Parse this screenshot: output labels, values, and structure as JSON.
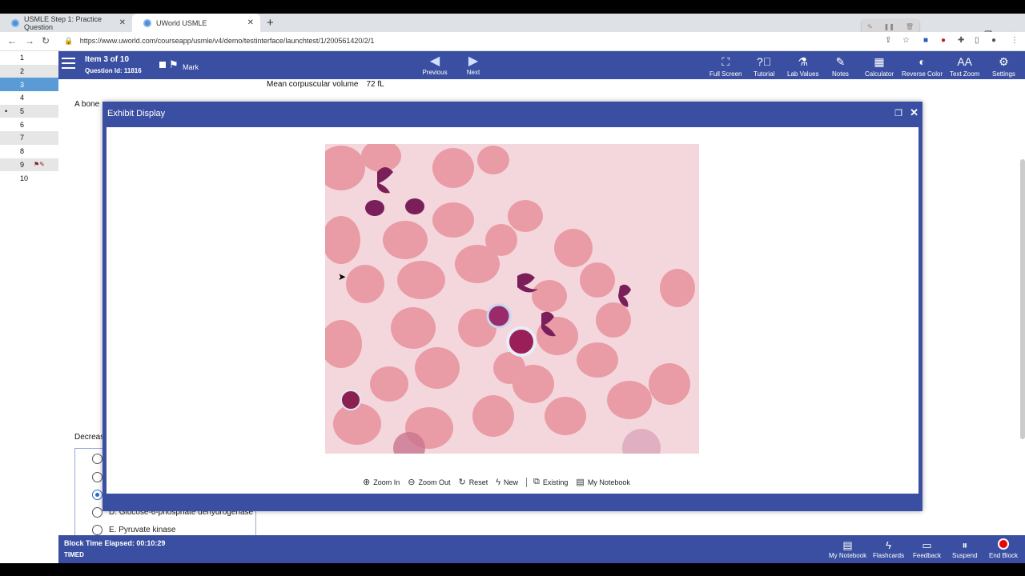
{
  "browser": {
    "tabs": [
      {
        "label": "USMLE Step 1: Practice Question"
      },
      {
        "label": "UWorld USMLE"
      }
    ],
    "url": "https://www.uworld.com/courseapp/usmle/v4/demo/testinterface/launchtest/1/200561420/2/1"
  },
  "question_list": [
    "1",
    "2",
    "3",
    "4",
    "5",
    "6",
    "7",
    "8",
    "9",
    "10"
  ],
  "header": {
    "item": "Item 3 of 10",
    "question_id": "Question Id: 11816",
    "mark": "Mark",
    "previous": "Previous",
    "next": "Next",
    "tools": [
      "Full Screen",
      "Tutorial",
      "Lab Values",
      "Notes",
      "Calculator",
      "Reverse Color",
      "Text Zoom",
      "Settings"
    ]
  },
  "content": {
    "mcv_label": "Mean corpuscular volume",
    "mcv_value": "72 fL",
    "stem_fragment": "A bone",
    "decrease_fragment": "Decreas",
    "options": [
      {
        "text": "",
        "selected": false
      },
      {
        "text": "",
        "selected": false
      },
      {
        "text": "",
        "selected": true
      },
      {
        "text": "D.  Glucose-6-phosphate dehydrogenase",
        "selected": false
      },
      {
        "text": "E.  Pyruvate kinase",
        "selected": false
      }
    ]
  },
  "modal": {
    "title": "Exhibit Display",
    "zoom_in": "Zoom In",
    "zoom_out": "Zoom Out",
    "reset": "Reset",
    "new": "New",
    "existing": "Existing",
    "notebook": "My Notebook"
  },
  "footer": {
    "elapsed": "Block Time Elapsed: 00:10:29",
    "timed": "TIMED",
    "buttons": [
      "My Notebook",
      "Flashcards",
      "Feedback",
      "Suspend",
      "End Block"
    ]
  }
}
